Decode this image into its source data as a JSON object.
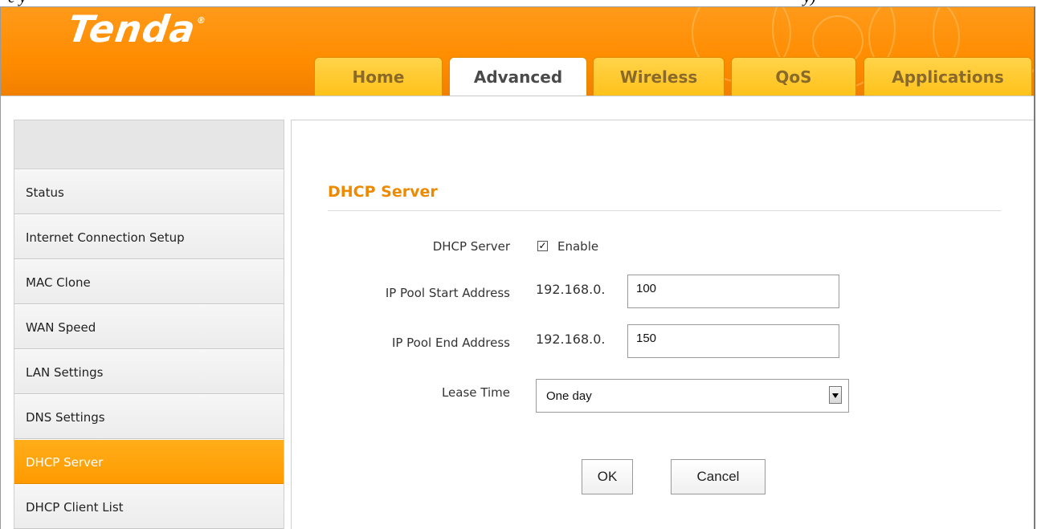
{
  "brand": {
    "logo_text": "Tenda",
    "logo_mark": "®"
  },
  "top_strip": {
    "left_text": "c     y",
    "right_text": "y)"
  },
  "tabs": [
    {
      "label": "Home",
      "active": false
    },
    {
      "label": "Advanced",
      "active": true
    },
    {
      "label": "Wireless",
      "active": false
    },
    {
      "label": "QoS",
      "active": false
    },
    {
      "label": "Applications",
      "active": false
    }
  ],
  "sidebar": {
    "items": [
      {
        "label": "Status",
        "active": false
      },
      {
        "label": "Internet Connection Setup",
        "active": false
      },
      {
        "label": "MAC Clone",
        "active": false
      },
      {
        "label": "WAN Speed",
        "active": false
      },
      {
        "label": "LAN Settings",
        "active": false
      },
      {
        "label": "DNS Settings",
        "active": false
      },
      {
        "label": "DHCP Server",
        "active": true
      },
      {
        "label": "DHCP Client List",
        "active": false
      }
    ]
  },
  "form": {
    "section_title": "DHCP Server",
    "dhcp_server_label": "DHCP Server",
    "enable_label": "Enable",
    "enable_checked": true,
    "check_glyph": "✓",
    "start_label": "IP Pool Start Address",
    "start_prefix": "192.168.0.",
    "start_value": "100",
    "end_label": "IP Pool End Address",
    "end_prefix": "192.168.0.",
    "end_value": "150",
    "lease_label": "Lease Time",
    "lease_value": "One day",
    "ok_label": "OK",
    "cancel_label": "Cancel"
  },
  "colors": {
    "brand_orange": "#ff8c00",
    "title_orange": "#ee8a00",
    "tab_yellow": "#ffc21a"
  }
}
